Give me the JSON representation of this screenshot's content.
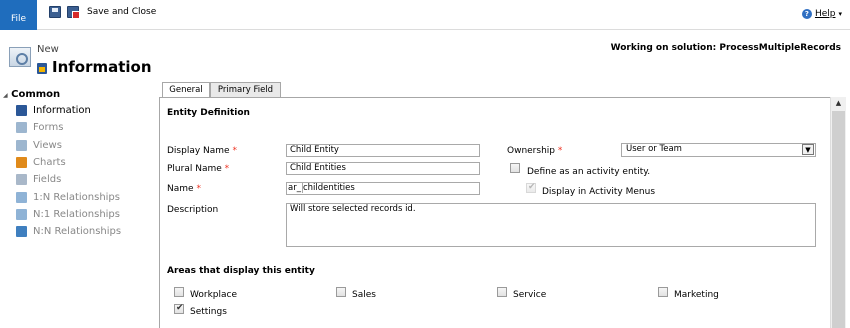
{
  "ribbon": {
    "file_label": "File",
    "save_close_label": "Save and Close",
    "help_label": "Help",
    "help_caret": "▾"
  },
  "header": {
    "new_label": "New",
    "title": "Information",
    "solution_text": "Working on solution: ProcessMultipleRecords"
  },
  "nav": {
    "group_label": "Common",
    "group_caret": "◢",
    "items": [
      {
        "label": "Information",
        "icon": "information-icon",
        "color": "#2b5797",
        "active": true
      },
      {
        "label": "Forms",
        "icon": "forms-icon",
        "color": "#9db6cf"
      },
      {
        "label": "Views",
        "icon": "views-icon",
        "color": "#9db6cf"
      },
      {
        "label": "Charts",
        "icon": "charts-icon",
        "color": "#e08a1a"
      },
      {
        "label": "Fields",
        "icon": "fields-icon",
        "color": "#a9b8c9"
      },
      {
        "label": "1:N Relationships",
        "icon": "relationship-1n-icon",
        "color": "#8fb3d6"
      },
      {
        "label": "N:1 Relationships",
        "icon": "relationship-n1-icon",
        "color": "#8fb3d6"
      },
      {
        "label": "N:N Relationships",
        "icon": "relationship-nn-icon",
        "color": "#3f7fbf"
      }
    ]
  },
  "tabs": [
    {
      "label": "General",
      "active": true
    },
    {
      "label": "Primary Field",
      "active": false
    }
  ],
  "entity_definition": {
    "section_title": "Entity Definition",
    "display_name_label": "Display Name",
    "display_name_value": "Child Entity",
    "plural_name_label": "Plural Name",
    "plural_name_value": "Child Entities",
    "name_label": "Name",
    "name_prefix": "ar_",
    "name_value": "childentities",
    "description_label": "Description",
    "description_value": "Will store selected records id.",
    "ownership_label": "Ownership",
    "ownership_value": "User or Team",
    "activity_label": "Define as an activity entity.",
    "activity_checked": false,
    "activity_menus_label": "Display in Activity Menus",
    "activity_menus_checked": true,
    "required_mark": "*"
  },
  "areas": {
    "section_title": "Areas that display this entity",
    "items": [
      {
        "label": "Workplace",
        "checked": false
      },
      {
        "label": "Sales",
        "checked": false
      },
      {
        "label": "Service",
        "checked": false
      },
      {
        "label": "Marketing",
        "checked": false
      },
      {
        "label": "Settings",
        "checked": true
      }
    ]
  },
  "colors": {
    "file_button": "#1f6dbd",
    "required": "#e32222"
  }
}
